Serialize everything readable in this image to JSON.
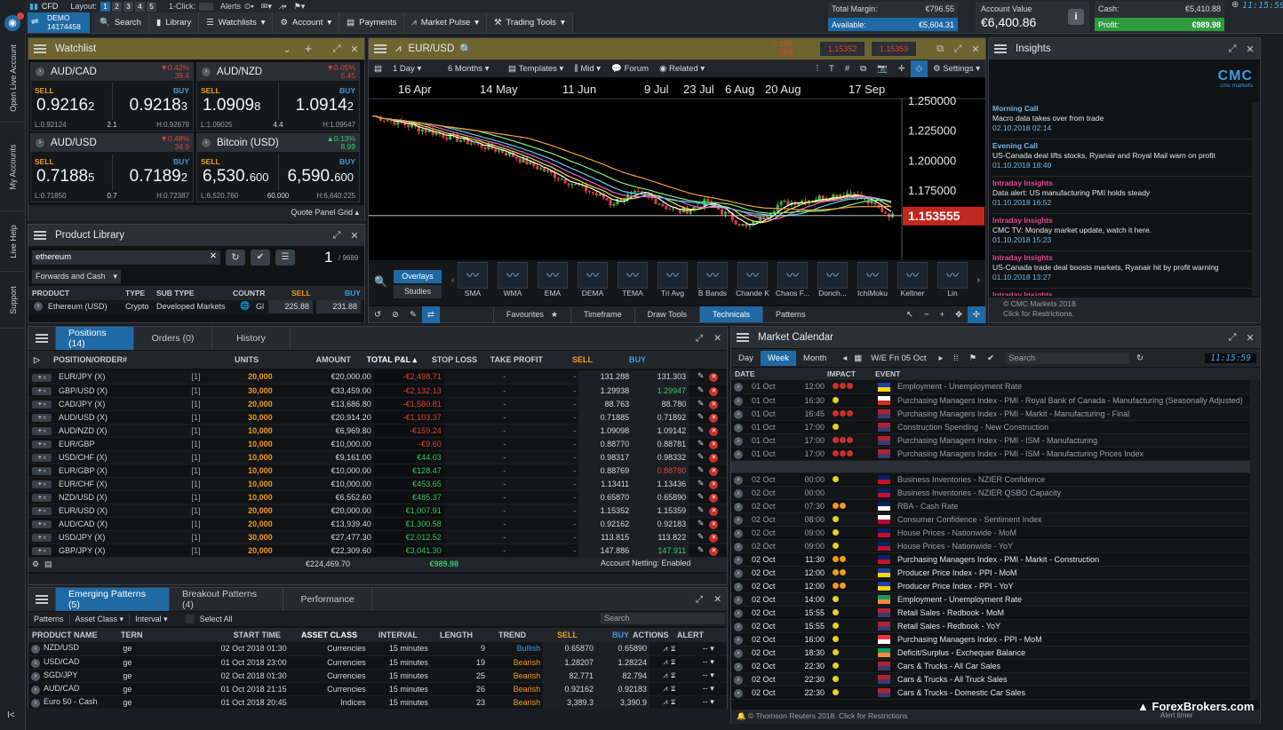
{
  "topbar": {
    "cfd": "CFD",
    "layout_label": "Layout:",
    "layouts": [
      "1",
      "2",
      "3",
      "4",
      "5"
    ],
    "oneclick": "1-Click:",
    "alerts": "Alerts",
    "account_type": "DEMO",
    "account_no": "14174458",
    "nav": [
      "Search",
      "Library",
      "Watchlists",
      "Account",
      "Payments",
      "Market Pulse",
      "Trading Tools"
    ],
    "total_margin_label": "Total Margin:",
    "total_margin": "€796.55",
    "available_label": "Available:",
    "available": "€5,604.31",
    "account_value_label": "Account Value",
    "account_value": "€6,400.86",
    "cash_label": "Cash:",
    "cash": "€5,410.88",
    "profit_label": "Profit:",
    "profit": "€989.98",
    "clock": "11:15:59"
  },
  "leftrail": {
    "tabs": [
      "Open Live Account",
      "My Accounts",
      "Live Help",
      "Support"
    ],
    "collapse": "I<"
  },
  "watchlist": {
    "title": "Watchlist",
    "tiles": [
      {
        "name": "AUD/CAD",
        "chg_pct": "0.42%",
        "chg_pts": "39.4",
        "dir": "down",
        "sell": "0.9216",
        "sell_sup": "2",
        "buy": "0.9218",
        "buy_sup": "3",
        "low": "L:0.92124",
        "spread": "2.1",
        "high": "H:0.92679"
      },
      {
        "name": "AUD/NZD",
        "chg_pct": "0.05%",
        "chg_pts": "6.45",
        "dir": "down",
        "sell": "1.0909",
        "sell_sup": "8",
        "buy": "1.0914",
        "buy_sup": "2",
        "low": "L:1.09025",
        "spread": "4.4",
        "high": "H:1.09547"
      },
      {
        "name": "AUD/USD",
        "chg_pct": "0.48%",
        "chg_pts": "34.9",
        "dir": "down",
        "sell": "0.7188",
        "sell_sup": "5",
        "buy": "0.7189",
        "buy_sup": "2",
        "low": "L:0.71850",
        "spread": "0.7",
        "high": "H:0.72387"
      },
      {
        "name": "Bitcoin (USD)",
        "chg_pct": "0.13%",
        "chg_pts": "8.99",
        "dir": "up",
        "sell": "6,530.",
        "sell_sup": "600",
        "buy": "6,590.",
        "buy_sup": "600",
        "low": "L:6,520.760",
        "spread": "60.000",
        "high": "H:6,640.225"
      }
    ],
    "sell": "SELL",
    "buy": "BUY",
    "footer": "Quote Panel Grid"
  },
  "library": {
    "title": "Product Library",
    "search": "ethereum",
    "count": "1",
    "count_total": "/ 9689",
    "filter": "Forwards and Cash",
    "cols": [
      "PRODUCT",
      "TYPE",
      "SUB TYPE",
      "COUNTR",
      "SELL",
      "BUY"
    ],
    "row": {
      "product": "Ethereum (USD)",
      "type": "Crypto",
      "subtype": "Developed Markets",
      "country": "Gl",
      "sell": "225.88",
      "buy": "231.88"
    }
  },
  "chart": {
    "symbol": "EUR/USD",
    "chg_pct": "0.25%",
    "chg_pts": "28.8",
    "sell": "1.15352",
    "buy": "1.15359",
    "interval": "1 Day",
    "range": "6 Months",
    "templates": "Templates",
    "mid": "Mid",
    "forum": "Forum",
    "related": "Related",
    "settings": "Settings",
    "dates": [
      "16 Apr",
      "14 May",
      "11 Jun",
      "9 Jul",
      "23 Jul",
      "6 Aug",
      "20 Aug",
      "17 Sep"
    ],
    "prices": [
      "1.250000",
      "1.225000",
      "1.200000",
      "1.175000"
    ],
    "current": "1.153555",
    "overlays": "Overlays",
    "studies": "Studies",
    "indicators": [
      "SMA",
      "WMA",
      "EMA",
      "DEMA",
      "TEMA",
      "Tri Avg",
      "B Bands",
      "Chande K",
      "Chaos F...",
      "Donch...",
      "IchiMoku",
      "Keltner",
      "Lin"
    ],
    "bottom_tabs": [
      "Favourites",
      "Timeframe",
      "Draw Tools",
      "Technicals",
      "Patterns"
    ]
  },
  "insights": {
    "title": "Insights",
    "logo": "CMC",
    "logo_sub": "cmc markets",
    "items": [
      {
        "h": "Morning Call",
        "t": "Macro data takes over from trade",
        "d": "02.10.2018 02:14",
        "c": "#6fb6ea"
      },
      {
        "h": "Evening Call",
        "t": "US-Canada deal lifts stocks, Ryanair and Royal Mail warn on profit",
        "d": "01.10.2018 18:40",
        "c": "#6fb6ea"
      },
      {
        "h": "Intraday Insights",
        "t": "Data alert: US manufacturing PMI holds steady",
        "d": "01.10.2018 16:52",
        "c": "#e0468e"
      },
      {
        "h": "Intraday Insights",
        "t": "CMC TV: Monday market update, watch it here.",
        "d": "01.10.2018 15:23",
        "c": "#e0468e"
      },
      {
        "h": "Intraday Insights",
        "t": "US-Canada trade deal boosts markets, Ryanair hit by profit warning",
        "d": "01.10.2018 13:27",
        "c": "#e0468e"
      },
      {
        "h": "Intraday Insights",
        "t": "",
        "d": "",
        "c": "#e0468e"
      }
    ],
    "footer1": "© CMC Markets 2018.",
    "footer2": "Click for Restrictions."
  },
  "positions": {
    "tabs": [
      "Positions (14)",
      "Orders (0)",
      "History"
    ],
    "cols": [
      "POSITION/ORDER#",
      "UNITS",
      "AMOUNT",
      "TOTAL P&L",
      "STOP LOSS",
      "TAKE PROFIT",
      "SELL",
      "BUY"
    ],
    "rows": [
      {
        "n": "EUR/JPY (X)",
        "c": "[1]",
        "u": "20,000",
        "a": "€20,000.00",
        "p": "-€2,498.71",
        "s": "-",
        "t": "-",
        "sell": "131.288",
        "buy": "131.303",
        "pc": "neg",
        "bc": "#d6d9dc"
      },
      {
        "n": "GBP/USD (X)",
        "c": "[1]",
        "u": "30,000",
        "a": "€33,459.00",
        "p": "-€2,132.13",
        "s": "-",
        "t": "-",
        "sell": "1.29938",
        "buy": "1.29947",
        "pc": "neg",
        "bc": "#39c46a"
      },
      {
        "n": "CAD/JPY (X)",
        "c": "[1]",
        "u": "20,000",
        "a": "€13,686.80",
        "p": "-€1,580.81",
        "s": "-",
        "t": "-",
        "sell": "88.763",
        "buy": "88.780",
        "pc": "neg",
        "bc": "#d6d9dc"
      },
      {
        "n": "AUD/USD (X)",
        "c": "[1]",
        "u": "30,000",
        "a": "€20,914.20",
        "p": "-€1,103.37",
        "s": "-",
        "t": "-",
        "sell": "0.71885",
        "buy": "0.71892",
        "pc": "neg",
        "bc": "#d6d9dc"
      },
      {
        "n": "AUD/NZD (X)",
        "c": "[1]",
        "u": "10,000",
        "a": "€6,969.80",
        "p": "-€159.24",
        "s": "-",
        "t": "-",
        "sell": "1.09098",
        "buy": "1.09142",
        "pc": "neg",
        "bc": "#d6d9dc"
      },
      {
        "n": "EUR/GBP",
        "c": "[1]",
        "u": "10,000",
        "a": "€10,000.00",
        "p": "-€9.60",
        "s": "-",
        "t": "-",
        "sell": "0.88770",
        "buy": "0.88781",
        "pc": "neg",
        "bc": "#d6d9dc"
      },
      {
        "n": "USD/CHF (X)",
        "c": "[1]",
        "u": "10,000",
        "a": "€9,161.00",
        "p": "€44.03",
        "s": "-",
        "t": "-",
        "sell": "0.98317",
        "buy": "0.98332",
        "pc": "pos",
        "bc": "#d6d9dc"
      },
      {
        "n": "EUR/GBP (X)",
        "c": "[1]",
        "u": "10,000",
        "a": "€10,000.00",
        "p": "€128.47",
        "s": "-",
        "t": "-",
        "sell": "0.88769",
        "buy": "0.88780",
        "pc": "pos",
        "bc": "#e0413b"
      },
      {
        "n": "EUR/CHF (X)",
        "c": "[1]",
        "u": "10,000",
        "a": "€10,000.00",
        "p": "€453.65",
        "s": "-",
        "t": "-",
        "sell": "1.13411",
        "buy": "1.13436",
        "pc": "pos",
        "bc": "#d6d9dc"
      },
      {
        "n": "NZD/USD (X)",
        "c": "[1]",
        "u": "10,000",
        "a": "€6,552.60",
        "p": "€485.37",
        "s": "-",
        "t": "-",
        "sell": "0.65870",
        "buy": "0.65890",
        "pc": "pos",
        "bc": "#d6d9dc"
      },
      {
        "n": "EUR/USD (X)",
        "c": "[1]",
        "u": "20,000",
        "a": "€20,000.00",
        "p": "€1,007.91",
        "s": "-",
        "t": "-",
        "sell": "1.15352",
        "buy": "1.15359",
        "pc": "pos",
        "bc": "#d6d9dc"
      },
      {
        "n": "AUD/CAD (X)",
        "c": "[1]",
        "u": "20,000",
        "a": "€13,939.40",
        "p": "€1,300.58",
        "s": "-",
        "t": "-",
        "sell": "0.92162",
        "buy": "0.92183",
        "pc": "pos",
        "bc": "#d6d9dc"
      },
      {
        "n": "USD/JPY (X)",
        "c": "[1]",
        "u": "30,000",
        "a": "€27,477.30",
        "p": "€2,012.52",
        "s": "-",
        "t": "-",
        "sell": "113.815",
        "buy": "113.822",
        "pc": "pos",
        "bc": "#d6d9dc"
      },
      {
        "n": "GBP/JPY (X)",
        "c": "[1]",
        "u": "20,000",
        "a": "€22,309.60",
        "p": "€3,041.30",
        "s": "-",
        "t": "-",
        "sell": "147.886",
        "buy": "147.911",
        "pc": "pos",
        "bc": "#39c46a"
      }
    ],
    "total_amount": "€224,469.70",
    "total_pnl": "€989.98",
    "netting": "Account Netting: Enabled"
  },
  "patterns": {
    "tabs": [
      "Emerging Patterns (5)",
      "Breakout Patterns (4)",
      "Performance"
    ],
    "filters": [
      "Patterns",
      "Asset Class",
      "Interval",
      "Select All"
    ],
    "search": "Search",
    "cols": [
      "PRODUCT NAME",
      "TERN",
      "START TIME",
      "ASSET CLASS",
      "INTERVAL",
      "LENGTH",
      "TREND",
      "SELL",
      "BUY",
      "ACTIONS",
      "ALERT"
    ],
    "rows": [
      {
        "n": "NZD/USD",
        "p": "ge",
        "st": "02 Oct 2018 01:30",
        "ac": "Currencies",
        "iv": "15 minutes",
        "l": "9",
        "tr": "Bullish",
        "sell": "0.65870",
        "buy": "0.65890",
        "tc": "#3d9be0"
      },
      {
        "n": "USD/CAD",
        "p": "ge",
        "st": "01 Oct 2018 23:00",
        "ac": "Currencies",
        "iv": "15 minutes",
        "l": "19",
        "tr": "Bearish",
        "sell": "1.28207",
        "buy": "1.28224",
        "tc": "#f29b1d"
      },
      {
        "n": "SGD/JPY",
        "p": "ge",
        "st": "02 Oct 2018 01:30",
        "ac": "Currencies",
        "iv": "15 minutes",
        "l": "25",
        "tr": "Bearish",
        "sell": "82.771",
        "buy": "82.794",
        "tc": "#f29b1d"
      },
      {
        "n": "AUD/CAD",
        "p": "ge",
        "st": "01 Oct 2018 21:15",
        "ac": "Currencies",
        "iv": "15 minutes",
        "l": "26",
        "tr": "Bearish",
        "sell": "0.92162",
        "buy": "0.92183",
        "tc": "#f29b1d"
      },
      {
        "n": "Euro 50 - Cash",
        "p": "ge",
        "st": "01 Oct 2018 20:45",
        "ac": "Indices",
        "iv": "15 minutes",
        "l": "23",
        "tr": "Bearish",
        "sell": "3,389.3",
        "buy": "3,390.9",
        "tc": "#f29b1d"
      }
    ]
  },
  "calendar": {
    "title": "Market Calendar",
    "tabs": [
      "Day",
      "Week",
      "Month"
    ],
    "week": "W/E Fri 05 Oct",
    "search": "Search",
    "clock": "11:15:59",
    "cols": [
      "DATE",
      "IMPACT",
      "EVENT"
    ],
    "rows": [
      {
        "d": "01 Oct",
        "t": "12:00",
        "imp": "rrr",
        "f": "eu",
        "e": "Employment - Unemployment Rate",
        "past": true
      },
      {
        "d": "01 Oct",
        "t": "16:30",
        "imp": "y",
        "f": "ca",
        "e": "Purchasing Managers Index - PMI - Royal Bank of Canada - Manufacturing (Seasonally Adjusted)",
        "past": true
      },
      {
        "d": "01 Oct",
        "t": "16:45",
        "imp": "rrr",
        "f": "us",
        "e": "Purchasing Managers Index - PMI - Markit - Manufacturing - Final",
        "past": true
      },
      {
        "d": "01 Oct",
        "t": "17:00",
        "imp": "y",
        "f": "us",
        "e": "Construction Spending - New Construction",
        "past": true
      },
      {
        "d": "01 Oct",
        "t": "17:00",
        "imp": "rrr",
        "f": "us",
        "e": "Purchasing Managers Index - PMI - ISM - Manufacturing",
        "past": true
      },
      {
        "d": "01 Oct",
        "t": "17:00",
        "imp": "rrr",
        "f": "us",
        "e": "Purchasing Managers Index - PMI - ISM - Manufacturing Prices Index",
        "past": true
      },
      {
        "sep": true
      },
      {
        "d": "02 Oct",
        "t": "00:00",
        "imp": "y",
        "f": "nz",
        "e": "Business Inventories - NZIER Confidence",
        "past": true
      },
      {
        "d": "02 Oct",
        "t": "00:00",
        "imp": "",
        "f": "nz",
        "e": "Business Inventories - NZIER QSBO Capacity",
        "past": true
      },
      {
        "d": "02 Oct",
        "t": "07:30",
        "imp": "oo",
        "f": "au",
        "e": "RBA - Cash Rate",
        "past": true
      },
      {
        "d": "02 Oct",
        "t": "08:00",
        "imp": "y",
        "f": "jp",
        "e": "Consumer Confidence - Sentiment Index",
        "past": true
      },
      {
        "d": "02 Oct",
        "t": "09:00",
        "imp": "y",
        "f": "uk",
        "e": "House Prices - Nationwide - MoM",
        "past": true
      },
      {
        "d": "02 Oct",
        "t": "09:00",
        "imp": "y",
        "f": "uk",
        "e": "House Prices - Nationwide - YoY",
        "past": true
      },
      {
        "d": "02 Oct",
        "t": "11:30",
        "imp": "oo",
        "f": "uk",
        "e": "Purchasing Managers Index - PMI - Markit - Construction",
        "past": false
      },
      {
        "d": "02 Oct",
        "t": "12:00",
        "imp": "oo",
        "f": "eu",
        "e": "Producer Price Index - PPI - MoM",
        "past": false
      },
      {
        "d": "02 Oct",
        "t": "12:00",
        "imp": "oo",
        "f": "eu",
        "e": "Producer Price Index - PPI - YoY",
        "past": false
      },
      {
        "d": "02 Oct",
        "t": "14:00",
        "imp": "y",
        "f": "ie",
        "e": "Employment - Unemployment Rate",
        "past": false
      },
      {
        "d": "02 Oct",
        "t": "15:55",
        "imp": "y",
        "f": "us",
        "e": "Retail Sales - Redbook - MoM",
        "past": false
      },
      {
        "d": "02 Oct",
        "t": "15:55",
        "imp": "y",
        "f": "us",
        "e": "Retail Sales - Redbook - YoY",
        "past": false
      },
      {
        "d": "02 Oct",
        "t": "16:00",
        "imp": "y",
        "f": "sg",
        "e": "Purchasing Managers Index - PPI - MoM",
        "past": false
      },
      {
        "d": "02 Oct",
        "t": "18:30",
        "imp": "y",
        "f": "ie",
        "e": "Deficit/Surplus - Exchequer Balance",
        "past": false
      },
      {
        "d": "02 Oct",
        "t": "22:30",
        "imp": "y",
        "f": "us",
        "e": "Cars & Trucks - All Car Sales",
        "past": false
      },
      {
        "d": "02 Oct",
        "t": "22:30",
        "imp": "y",
        "f": "us",
        "e": "Cars & Trucks - All Truck Sales",
        "past": false
      },
      {
        "d": "02 Oct",
        "t": "22:30",
        "imp": "y",
        "f": "us",
        "e": "Cars & Trucks - Domestic Car Sales",
        "past": false
      }
    ],
    "footer": "© Thomson Reuters 2018. Click for Restrictions"
  },
  "watermark": "ForexBrokers.com",
  "alert_timer": "Alert timer"
}
